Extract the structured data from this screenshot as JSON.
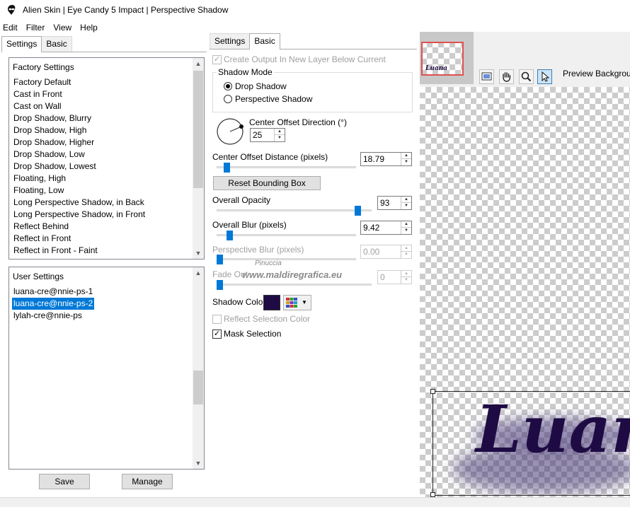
{
  "window": {
    "title": "Alien Skin | Eye Candy 5 Impact | Perspective Shadow"
  },
  "menu": [
    "Edit",
    "Filter",
    "View",
    "Help"
  ],
  "left": {
    "tabs": [
      "Settings",
      "Basic"
    ],
    "factory": {
      "header": "Factory Settings",
      "items": [
        "Factory Default",
        "Cast in Front",
        "Cast on Wall",
        "Drop Shadow, Blurry",
        "Drop Shadow, High",
        "Drop Shadow, Higher",
        "Drop Shadow, Low",
        "Drop Shadow, Lowest",
        "Floating, High",
        "Floating, Low",
        "Long Perspective Shadow, in Back",
        "Long Perspective Shadow, in Front",
        "Reflect Behind",
        "Reflect in Front",
        "Reflect in Front - Faint"
      ]
    },
    "user": {
      "header": "User Settings",
      "items": [
        "luana-cre@nnie-ps-1",
        "luana-cre@nnie-ps-2",
        "lylah-cre@nnie-ps"
      ],
      "selected_index": 1
    },
    "buttons": {
      "save": "Save",
      "manage": "Manage"
    }
  },
  "middle": {
    "tabs": [
      "Settings",
      "Basic"
    ],
    "create_output": {
      "label": "Create Output In New Layer Below Current",
      "checked": true,
      "enabled": false
    },
    "shadow_mode": {
      "legend": "Shadow Mode",
      "options": [
        "Drop Shadow",
        "Perspective Shadow"
      ],
      "selected": "Drop Shadow"
    },
    "center_offset_direction": {
      "label": "Center Offset Direction (°)",
      "value": "25"
    },
    "center_offset_distance": {
      "label": "Center Offset Distance (pixels)",
      "value": "18.79",
      "slider_fraction": 0.07
    },
    "reset_bounding_box": "Reset Bounding Box",
    "overall_opacity": {
      "label": "Overall Opacity",
      "value": "93",
      "slider_fraction": 0.93
    },
    "overall_blur": {
      "label": "Overall Blur (pixels)",
      "value": "9.42",
      "slider_fraction": 0.09
    },
    "perspective_blur": {
      "label": "Perspective Blur (pixels)",
      "value": "0.00",
      "enabled": false
    },
    "fade_out": {
      "label": "Fade Out",
      "value": "0",
      "enabled": false
    },
    "shadow_color": {
      "label": "Shadow Color",
      "color": "#1e0b44"
    },
    "reflect_selection_color": {
      "label": "Reflect Selection Color",
      "checked": false,
      "enabled": false
    },
    "mask_selection": {
      "label": "Mask Selection",
      "checked": true
    }
  },
  "watermark": {
    "line1": "Pinuccia",
    "line2": "www.maldiregrafica.eu"
  },
  "preview": {
    "thumbnail_text": "Luana",
    "background_label": "Preview Background",
    "text": "Luan",
    "text_color": "#1e0b44",
    "tools": [
      "screen-icon",
      "hand-icon",
      "zoom-icon",
      "pointer-icon"
    ]
  }
}
